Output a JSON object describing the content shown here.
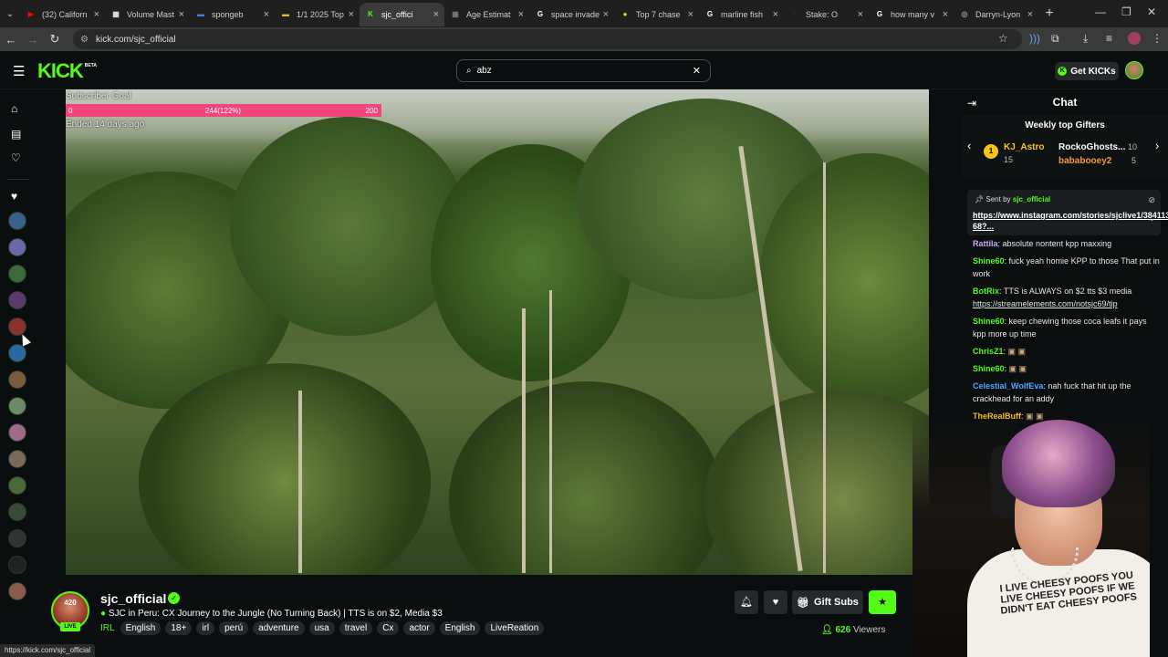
{
  "browser": {
    "tabs": [
      {
        "title": "(32) Californ",
        "fav": "▶",
        "color": "#ff0000"
      },
      {
        "title": "Volume Mast",
        "fav": "▦",
        "color": "#e5e5e5"
      },
      {
        "title": "spongeb",
        "fav": "▬",
        "color": "#4a7bd6"
      },
      {
        "title": "1/1 2025 Top",
        "fav": "▬",
        "color": "#e8b923"
      },
      {
        "title": "sjc_offici",
        "fav": "K",
        "color": "#53fc18"
      },
      {
        "title": "Age Estimat",
        "fav": "▦",
        "color": "#777"
      },
      {
        "title": "space invade",
        "fav": "G",
        "color": "#ffffff"
      },
      {
        "title": "Top 7 chase",
        "fav": "●",
        "color": "#f7d31c"
      },
      {
        "title": "marline fish",
        "fav": "G",
        "color": "#ffffff"
      },
      {
        "title": "Stake: O",
        "fav": "S",
        "color": "#1a2c38"
      },
      {
        "title": "how many v",
        "fav": "G",
        "color": "#ffffff"
      },
      {
        "title": "Darryn-Lyon",
        "fav": "◎",
        "color": "#999"
      }
    ],
    "url": "kick.com/sjc_official",
    "status_url": "https://kick.com/sjc_official"
  },
  "header": {
    "logo": "KICK",
    "logo_badge": "BETA",
    "search_value": "abz",
    "get_kicks": "Get KICKs"
  },
  "goal": {
    "title": "Subscriber Goal",
    "start": "0",
    "progress_text": "244(122%)",
    "target": "200",
    "ended": "Ended 14 days ago",
    "progress_fraction": 1.0
  },
  "stream": {
    "channel": "sjc_official",
    "avatar_text": "420",
    "live": "LIVE",
    "title": "SJC in Peru: CX Journey to the Jungle (No Turning Back) | TTS is on $2, Media $3",
    "category": "IRL",
    "tags": [
      "English",
      "18+",
      "irl",
      "perú",
      "adventure",
      "usa",
      "travel",
      "Cx",
      "actor",
      "English",
      "LiveReation"
    ],
    "gift_subs": "Gift Subs",
    "viewers": "626",
    "viewers_label": "Viewers"
  },
  "chat": {
    "title": "Chat",
    "gifters_title": "Weekly top Gifters",
    "rank": "1",
    "gifters": [
      {
        "name": "KJ_Astro",
        "count": "15",
        "color": "#f5c518"
      },
      {
        "name": "RockoGhosts...",
        "count": "10",
        "color": "#ffffff"
      },
      {
        "name": "bababooey2",
        "count": "5",
        "color": "#f39a3d"
      }
    ],
    "pinned": {
      "sent_by": "Sent by",
      "user": "sjc_official",
      "link": "https://www.instagram.com/stories/sjclive1/38411340783813263​68?..."
    },
    "messages": [
      {
        "user": "Rattila",
        "color": "#c9a8f0",
        "text": "absolute nontent kpp maxxing",
        "link": ""
      },
      {
        "user": "Shine60",
        "color": "#53fc18",
        "text": "fuck yeah homie KPP to those That put in work",
        "link": ""
      },
      {
        "user": "BotRix",
        "color": "#53fc18",
        "text": "TTS is ALWAYS on $2 tts $3 media",
        "link": "https://streamelements.com/notsjc69/tip"
      },
      {
        "user": "Shine60",
        "color": "#53fc18",
        "text": "keep chewing those coca leafs it pays kpp more up time",
        "link": ""
      },
      {
        "user": "ChrisZ1",
        "color": "#53fc18",
        "text": "",
        "link": ""
      },
      {
        "user": "Shine60",
        "color": "#53fc18",
        "text": "",
        "link": ""
      },
      {
        "user": "Celestial_WolfEva",
        "color": "#4fa8ff",
        "text": "nah fuck that hit up the crackhead for an addy",
        "link": ""
      },
      {
        "user": "TheRealBuff",
        "color": "#f5c518",
        "text": "",
        "link": ""
      }
    ]
  },
  "webcam": {
    "shirt_text": "I LIVE CHEESY POOFS YOU LIVE CHEESY POOFS IF WE DIDN'T EAT CHEESY POOFS"
  }
}
